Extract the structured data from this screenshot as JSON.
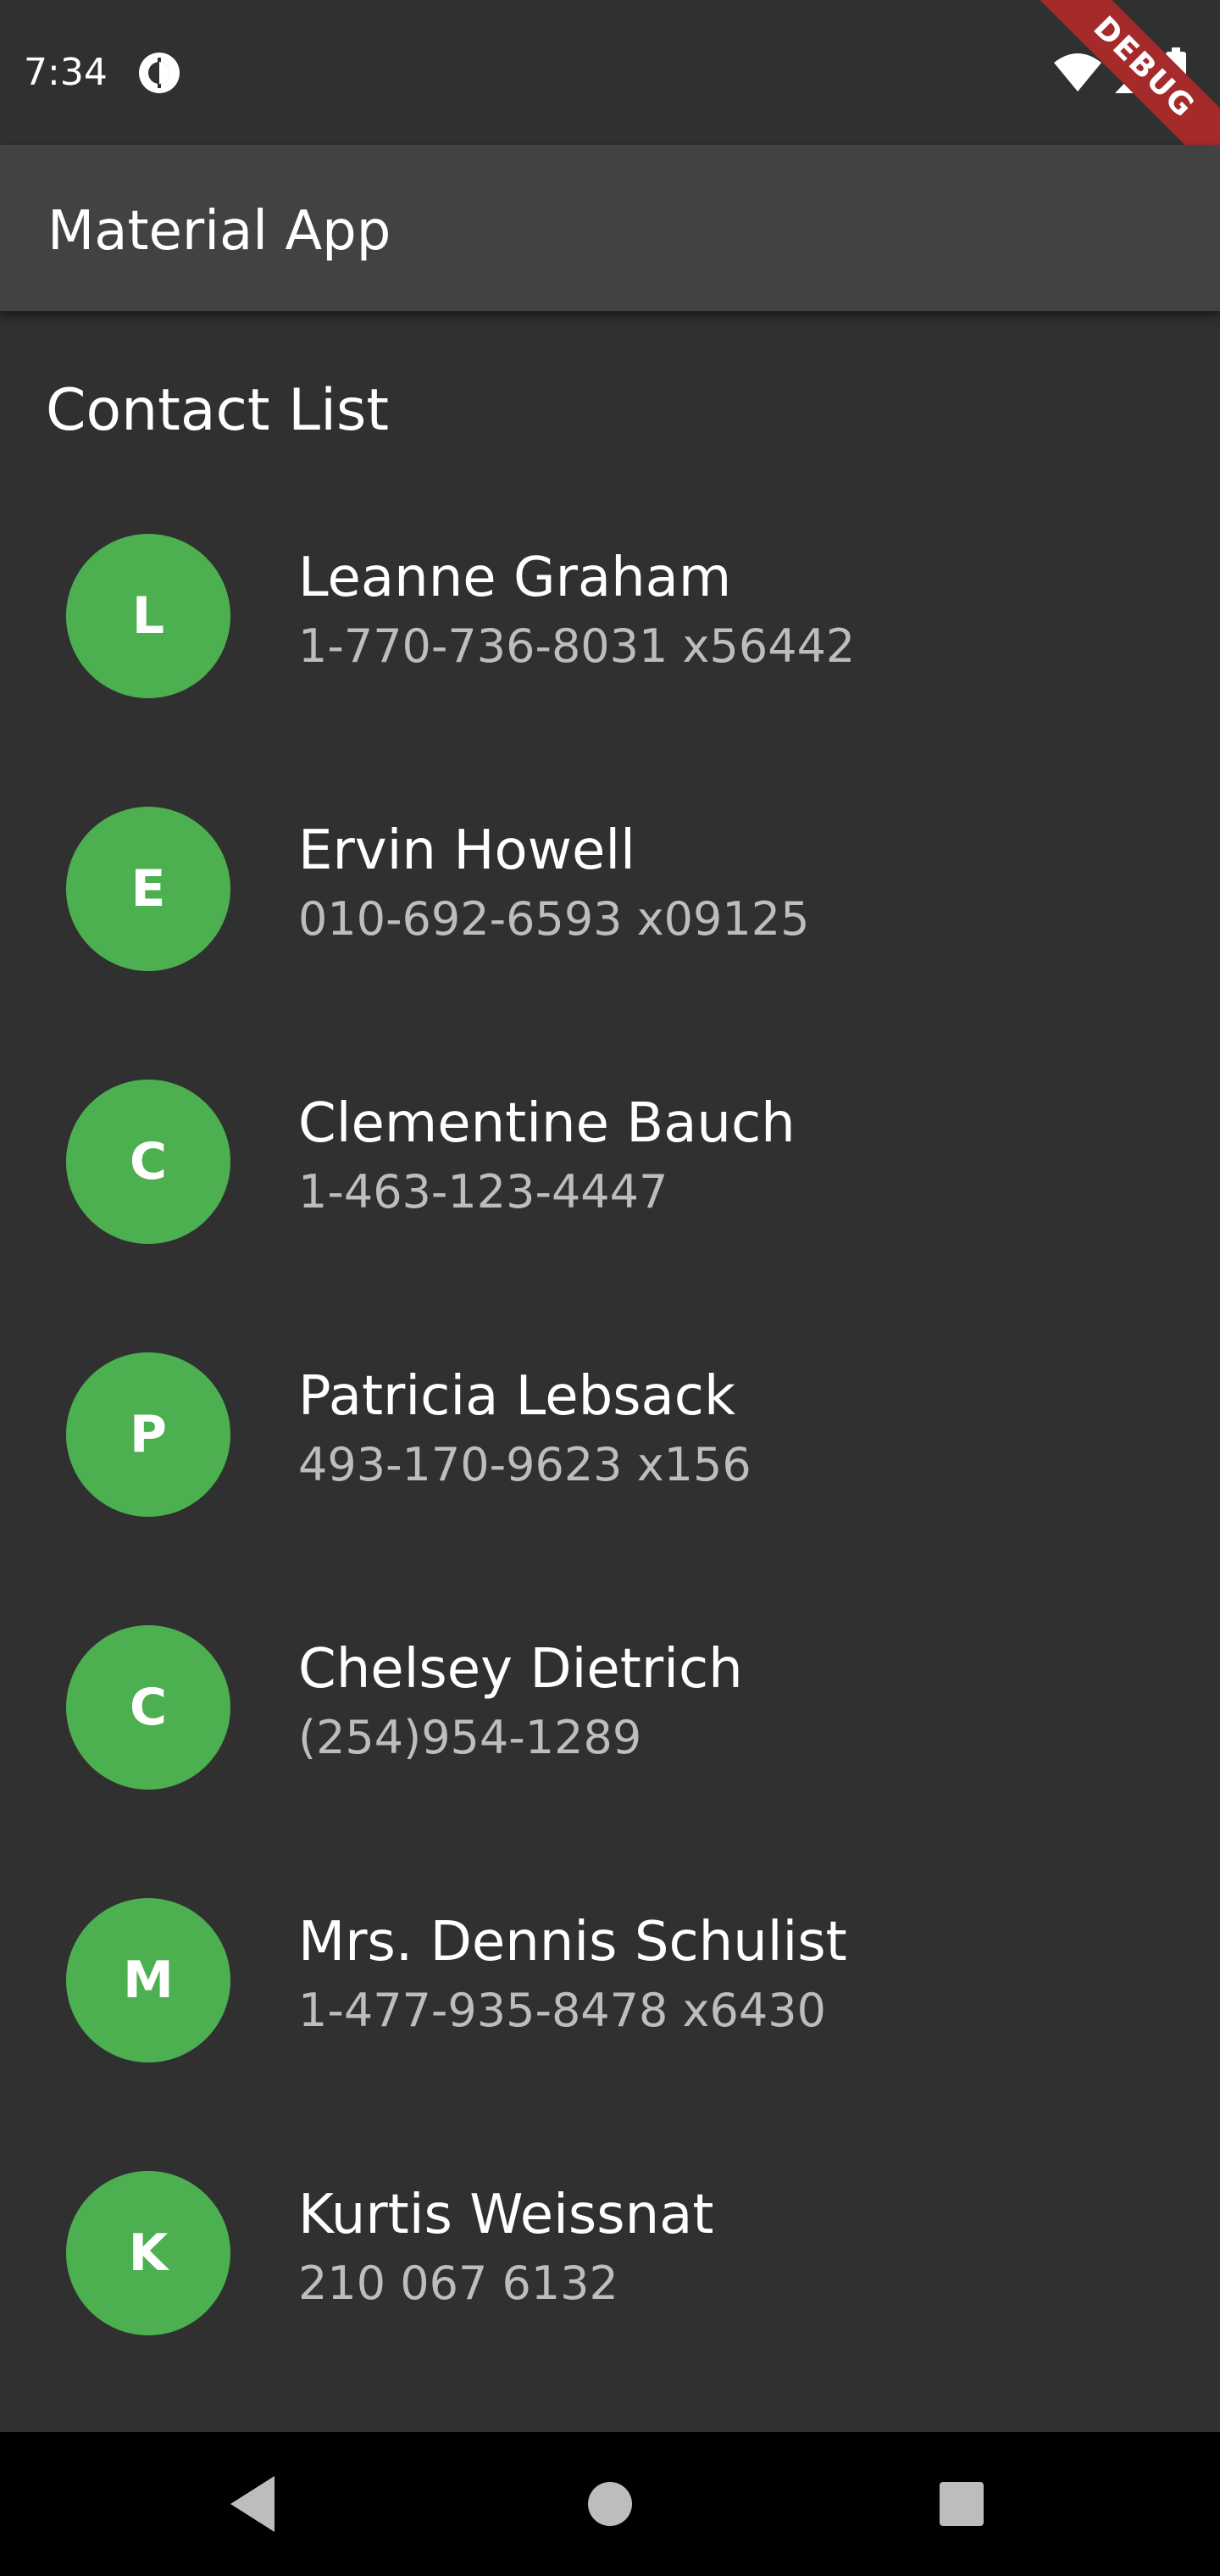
{
  "status_bar": {
    "time": "7:34",
    "icons": [
      "app-indicator-icon",
      "wifi-icon",
      "cellular-signal-icon",
      "battery-icon"
    ],
    "debug_banner": "DEBUG"
  },
  "app_bar": {
    "title": "Material App",
    "background": "#424242"
  },
  "section": {
    "title": "Contact List"
  },
  "accent_color": "#4caf50",
  "contacts": [
    {
      "initial": "L",
      "name": "Leanne Graham",
      "phone": "1-770-736-8031 x56442"
    },
    {
      "initial": "E",
      "name": "Ervin Howell",
      "phone": "010-692-6593 x09125"
    },
    {
      "initial": "C",
      "name": "Clementine Bauch",
      "phone": "1-463-123-4447"
    },
    {
      "initial": "P",
      "name": "Patricia Lebsack",
      "phone": "493-170-9623 x156"
    },
    {
      "initial": "C",
      "name": "Chelsey Dietrich",
      "phone": "(254)954-1289"
    },
    {
      "initial": "M",
      "name": "Mrs. Dennis Schulist",
      "phone": "1-477-935-8478 x6430"
    },
    {
      "initial": "K",
      "name": "Kurtis Weissnat",
      "phone": "210 067 6132"
    }
  ],
  "nav_bar": {
    "buttons": [
      "back-icon",
      "home-icon",
      "recents-icon"
    ]
  }
}
